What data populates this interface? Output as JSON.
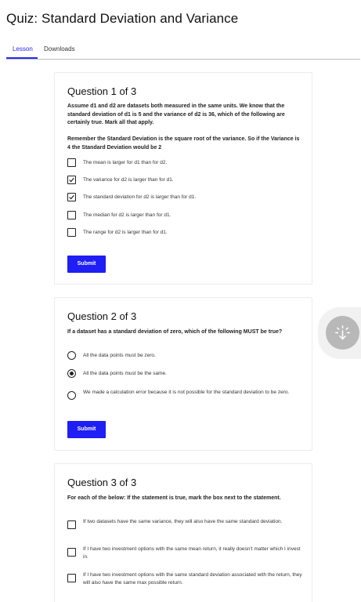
{
  "page": {
    "title": "Quiz: Standard Deviation and Variance"
  },
  "tabs": [
    {
      "label": "Lesson",
      "active": true
    },
    {
      "label": "Downloads",
      "active": false
    }
  ],
  "colors": {
    "accent": "#1e1ef5",
    "fab": "#b8b8b8"
  },
  "q1": {
    "title": "Question 1 of 3",
    "prompt": "Assume d1 and d2 are datasets both measured in the same units. We know that the standard deviation of d1 is 5 and the variance of d2 is 36, which of the following are certainly true. Mark all that apply.",
    "hint": "Remember the Standard Deviation is the square root of the variance. So if the Variance is 4 the Standard Deviation would be 2",
    "options": [
      {
        "label": "The mean is larger for d1 than for d2.",
        "checked": false
      },
      {
        "label": "The variance for d2 is larger than for d1.",
        "checked": true
      },
      {
        "label": "The standard deviation for d2 is larger than for d1.",
        "checked": true
      },
      {
        "label": "The median for d2 is larger than for d1.",
        "checked": false
      },
      {
        "label": "The range for d2 is larger than for d1.",
        "checked": false
      }
    ],
    "submit": "Submit"
  },
  "q2": {
    "title": "Question 2 of 3",
    "prompt": "If a dataset has a standard deviation of zero, which of the following MUST be true?",
    "options": [
      {
        "label": "All the data points must be zero.",
        "selected": false
      },
      {
        "label": "All the data points must be the same.",
        "selected": true
      },
      {
        "label": "We made a calculation error because it is not possible for the standard deviation to be zero.",
        "selected": false
      }
    ],
    "submit": "Submit"
  },
  "q3": {
    "title": "Question 3 of 3",
    "prompt": "For each of the below: If the statement is true, mark the box next to the statement.",
    "options": [
      {
        "label": "If two datasets have the same variance, they will also have the same standard deviation.",
        "checked": false
      },
      {
        "label": "If I have two investment options with the same mean return, it really doesn't matter which I invest in.",
        "checked": false
      },
      {
        "label": "If I have two investment options with the same standard deviation associated with the return, they will also have the same max possible return.",
        "checked": false
      }
    ]
  },
  "fab": {
    "icon": "sparkle-arrow-icon"
  }
}
